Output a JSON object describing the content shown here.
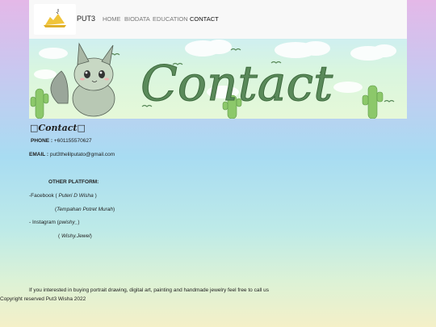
{
  "nav": {
    "brand": "PUT3",
    "links": [
      {
        "label": "HOME"
      },
      {
        "label": "BIODATA"
      },
      {
        "label": "EDUCATION"
      },
      {
        "label": "CONTACT",
        "active": true
      }
    ]
  },
  "banner": {
    "word": "Contact"
  },
  "contact": {
    "title": "□Contact□",
    "phone_label": "PHONE :",
    "phone": "+601155570627",
    "email_label": "EMAIL :",
    "email": "put3thelilputato@gmail.com",
    "other_heading": "OTHER PLATFORM:",
    "facebook_prefix": "-Facebook (",
    "facebook_name": "Puteri D Wisha",
    "facebook_suffix": ")",
    "facebook2_open": "(",
    "facebook2_name": "Tempahan Potret Murah",
    "facebook2_close": ")",
    "instagram_prefix": "- Instagram (",
    "instagram_name": "pwishy_",
    "instagram_suffix": ")",
    "instagram2_open": "(",
    "instagram2_name": "Wishy.Jewel",
    "instagram2_close": ")",
    "note": "If you interested in buying portrait drawing, digital art, painting and handmade jewelry feel free to call us"
  },
  "footer": {
    "copyright": "Copyright reserved Put3 Wisha 2022"
  },
  "colors": {
    "banner_text": "#5a8a5a",
    "cactus": "#8cc86a"
  }
}
